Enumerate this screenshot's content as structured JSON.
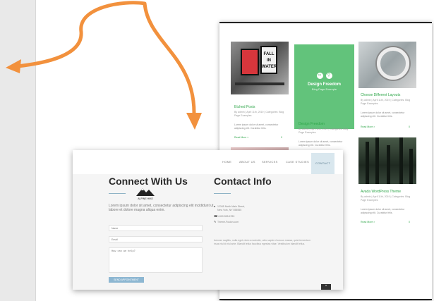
{
  "blog": {
    "tile1": {
      "frame_text": "FALL IN WATER",
      "title": "Etched Posts",
      "meta": "By admin | April 11th, 2019 | Categories: Blog Page Examples",
      "excerpt": "Lorem ipsum dolor sit amet, consectetur adipiscing elit. Curabitur felis.",
      "read_more": "Read More >",
      "likes": "0"
    },
    "tile2": {
      "card_title": "Design Freedom",
      "card_sub": "Blog Page Example",
      "title": "Design Freedom",
      "meta": "By admin | April 11th, 2019 | Categories: Blog Page Examples",
      "excerpt": "Lorem ipsum dolor sit amet, consectetur adipiscing elit. Curabitur felis."
    },
    "tile3": {
      "title": "Choose Different Layouts",
      "meta": "By admin | April 11th, 2019 | Categories: Blog Page Examples",
      "excerpt": "Lorem ipsum dolor sit amet, consectetur adipiscing elit. Curabitur felis.",
      "read_more": "Read More >",
      "likes": "0"
    },
    "tile4": {
      "title": "Avada WordPress Theme",
      "meta": "By admin | April 11th, 2019 | Categories: Blog Page Examples",
      "excerpt": "Lorem ipsum dolor sit amet, consectetur adipiscing elit. Curabitur felis.",
      "read_more": "Read More >",
      "likes": "0"
    }
  },
  "contact": {
    "nav": [
      "HOME",
      "ABOUT US",
      "SERVICES",
      "CASE STUDIES",
      "CONTACT"
    ],
    "connect_title": "Connect With Us",
    "contact_title": "Contact Info",
    "logo_text": "ALPINE HIKE",
    "lorem": "Lorem ipsum dolor sit amet, consectetur adipiscing elit incididunt ut labore et dolore magna aliqua enim.",
    "name_placeholder": "Name",
    "email_placeholder": "Email",
    "message_placeholder": "How can we help?",
    "send_label": "SEND APPOINTMENT",
    "address_line1": "12345 North Main Street,",
    "address_line2": "New York, NY 555555",
    "phone": "1.800.555.6789",
    "email": "Theme-Fusion.com",
    "paragraph": "Aenean sagittis, nulla eget viverra molestie, odio sapien rhoncus massa, quis fermentum risus nisi id nisl ante. Blandit tellus faucibus egestas vitae. Vestibulum blandit tellus.",
    "top_label": "^"
  },
  "colors": {
    "arrow": "#f2913d",
    "green": "#62c37b",
    "accent_blue": "#8db7d2"
  }
}
